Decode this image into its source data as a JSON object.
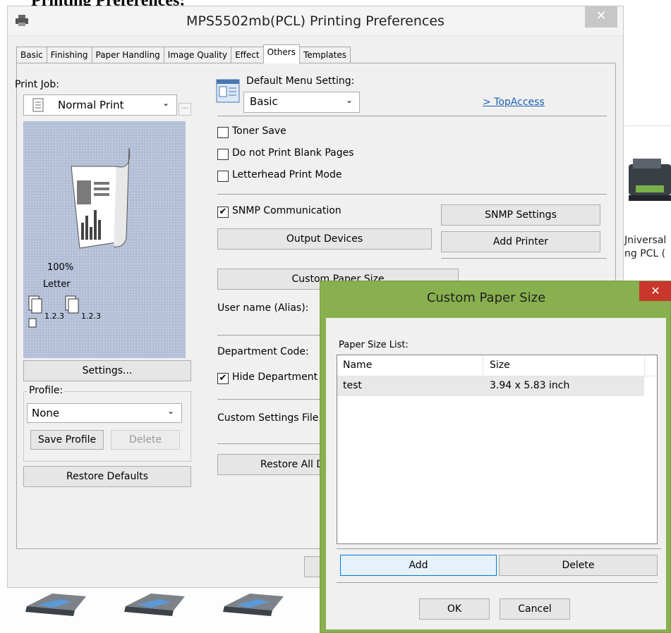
{
  "doc_heading": "Printing Preferences:",
  "background": {
    "printer_label_line1": "Jniversal",
    "printer_label_line2": "ng PCL (",
    "printer_row_count": 3
  },
  "window": {
    "title": "MPS5502mb(PCL) Printing Preferences",
    "close_glyph": "✕",
    "tabs": [
      {
        "label": "Basic",
        "active": false
      },
      {
        "label": "Finishing",
        "active": false
      },
      {
        "label": "Paper Handling",
        "active": false
      },
      {
        "label": "Image Quality",
        "active": false
      },
      {
        "label": "Effect",
        "active": false
      },
      {
        "label": "Others",
        "active": true
      },
      {
        "label": "Templates",
        "active": false
      }
    ]
  },
  "left": {
    "print_job_label": "Print Job:",
    "print_job_value": "Normal Print",
    "ellipsis": "...",
    "preview": {
      "scale": "100%",
      "paper": "Letter",
      "collate_a": "1.2.3",
      "collate_b": "1.2.3"
    },
    "settings_button": "Settings...",
    "profile_label": "Profile:",
    "profile_value": "None",
    "save_profile_button": "Save Profile",
    "delete_button": "Delete",
    "restore_defaults_button": "Restore Defaults"
  },
  "right": {
    "default_menu_label": "Default Menu Setting:",
    "default_menu_value": "Basic",
    "topaccess_link": "> TopAccess",
    "toner_save": {
      "label": "Toner Save",
      "checked": false
    },
    "no_blank_pages": {
      "label": "Do not Print Blank Pages",
      "checked": false
    },
    "letterhead_mode": {
      "label": "Letterhead Print Mode",
      "checked": false
    },
    "snmp": {
      "label": "SNMP Communication",
      "checked": true
    },
    "snmp_settings_button": "SNMP Settings",
    "output_devices_button": "Output Devices",
    "add_printer_button": "Add Printer",
    "custom_paper_size_button": "Custom Paper Size",
    "user_name_label": "User name (Alias):",
    "department_code_label": "Department Code:",
    "hide_department": {
      "label": "Hide Department",
      "checked": true
    },
    "custom_settings_label": "Custom Settings File",
    "restore_all_button": "Restore All D"
  },
  "dialog": {
    "title": "Custom Paper Size",
    "close_glyph": "✕",
    "list_label": "Paper Size List:",
    "columns": [
      "Name",
      "Size"
    ],
    "rows": [
      {
        "name": "test",
        "size": "3.94 x 5.83 inch"
      }
    ],
    "add_button": "Add",
    "delete_button": "Delete",
    "ok_button": "OK",
    "cancel_button": "Cancel"
  },
  "colors": {
    "dialog_frame": "#88b04e",
    "close_red": "#c9362b",
    "link_blue": "#1a5fb4",
    "preview_blue": "#b2bed6"
  }
}
